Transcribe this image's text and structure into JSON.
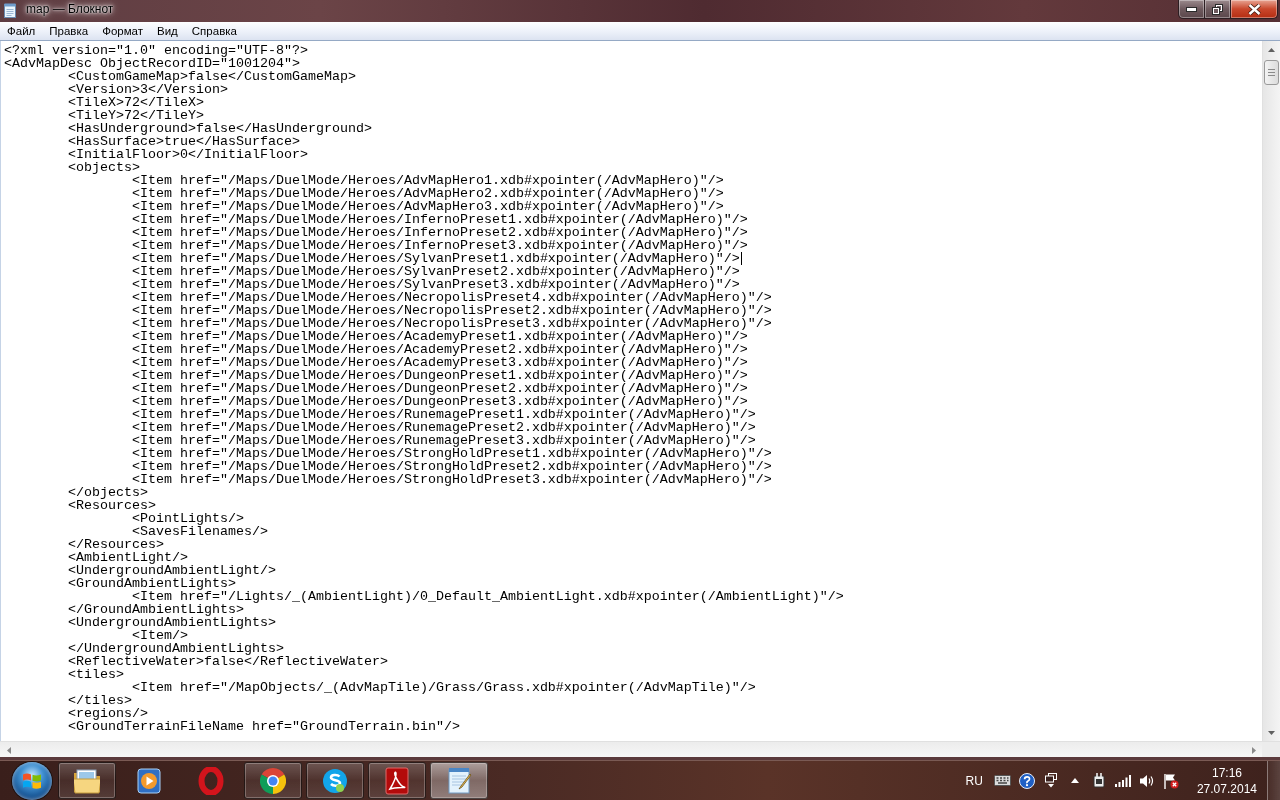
{
  "window": {
    "title": "map — Блокнот"
  },
  "menu": [
    "Файл",
    "Правка",
    "Формат",
    "Вид",
    "Справка"
  ],
  "editor": {
    "lines": [
      {
        "text": "<?xml version=\"1.0\" encoding=\"UTF-8\"?>",
        "caret": false
      },
      {
        "text": "<AdvMapDesc ObjectRecordID=\"1001204\">",
        "caret": false,
        "children": [
          {
            "text": "<CustomGameMap>false</CustomGameMap>",
            "caret": false
          },
          {
            "text": "<Version>3</Version>",
            "caret": false
          },
          {
            "text": "<TileX>72</TileX>",
            "caret": false
          },
          {
            "text": "<TileY>72</TileY>",
            "caret": false
          },
          {
            "text": "<HasUnderground>false</HasUnderground>",
            "caret": false
          },
          {
            "text": "<HasSurface>true</HasSurface>",
            "caret": false
          },
          {
            "text": "<InitialFloor>0</InitialFloor>",
            "caret": false
          },
          {
            "text": "<objects>",
            "caret": false,
            "children": [
              {
                "text": "<Item href=\"/Maps/DuelMode/Heroes/AdvMapHero1.xdb#xpointer(/AdvMapHero)\"/>",
                "caret": false
              },
              {
                "text": "<Item href=\"/Maps/DuelMode/Heroes/AdvMapHero2.xdb#xpointer(/AdvMapHero)\"/>",
                "caret": false
              },
              {
                "text": "<Item href=\"/Maps/DuelMode/Heroes/AdvMapHero3.xdb#xpointer(/AdvMapHero)\"/>",
                "caret": false
              },
              {
                "text": "<Item href=\"/Maps/DuelMode/Heroes/InfernoPreset1.xdb#xpointer(/AdvMapHero)\"/>",
                "caret": false
              },
              {
                "text": "<Item href=\"/Maps/DuelMode/Heroes/InfernoPreset2.xdb#xpointer(/AdvMapHero)\"/>",
                "caret": false
              },
              {
                "text": "<Item href=\"/Maps/DuelMode/Heroes/InfernoPreset3.xdb#xpointer(/AdvMapHero)\"/>",
                "caret": false
              },
              {
                "text": "<Item href=\"/Maps/DuelMode/Heroes/SylvanPreset1.xdb#xpointer(/AdvMapHero)\"/>",
                "caret": true
              },
              {
                "text": "<Item href=\"/Maps/DuelMode/Heroes/SylvanPreset2.xdb#xpointer(/AdvMapHero)\"/>",
                "caret": false
              },
              {
                "text": "<Item href=\"/Maps/DuelMode/Heroes/SylvanPreset3.xdb#xpointer(/AdvMapHero)\"/>",
                "caret": false
              },
              {
                "text": "<Item href=\"/Maps/DuelMode/Heroes/NecropolisPreset4.xdb#xpointer(/AdvMapHero)\"/>",
                "caret": false
              },
              {
                "text": "<Item href=\"/Maps/DuelMode/Heroes/NecropolisPreset2.xdb#xpointer(/AdvMapHero)\"/>",
                "caret": false
              },
              {
                "text": "<Item href=\"/Maps/DuelMode/Heroes/NecropolisPreset3.xdb#xpointer(/AdvMapHero)\"/>",
                "caret": false
              },
              {
                "text": "<Item href=\"/Maps/DuelMode/Heroes/AcademyPreset1.xdb#xpointer(/AdvMapHero)\"/>",
                "caret": false
              },
              {
                "text": "<Item href=\"/Maps/DuelMode/Heroes/AcademyPreset2.xdb#xpointer(/AdvMapHero)\"/>",
                "caret": false
              },
              {
                "text": "<Item href=\"/Maps/DuelMode/Heroes/AcademyPreset3.xdb#xpointer(/AdvMapHero)\"/>",
                "caret": false
              },
              {
                "text": "<Item href=\"/Maps/DuelMode/Heroes/DungeonPreset1.xdb#xpointer(/AdvMapHero)\"/>",
                "caret": false
              },
              {
                "text": "<Item href=\"/Maps/DuelMode/Heroes/DungeonPreset2.xdb#xpointer(/AdvMapHero)\"/>",
                "caret": false
              },
              {
                "text": "<Item href=\"/Maps/DuelMode/Heroes/DungeonPreset3.xdb#xpointer(/AdvMapHero)\"/>",
                "caret": false
              },
              {
                "text": "<Item href=\"/Maps/DuelMode/Heroes/RunemagePreset1.xdb#xpointer(/AdvMapHero)\"/>",
                "caret": false
              },
              {
                "text": "<Item href=\"/Maps/DuelMode/Heroes/RunemagePreset2.xdb#xpointer(/AdvMapHero)\"/>",
                "caret": false
              },
              {
                "text": "<Item href=\"/Maps/DuelMode/Heroes/RunemagePreset3.xdb#xpointer(/AdvMapHero)\"/>",
                "caret": false
              },
              {
                "text": "<Item href=\"/Maps/DuelMode/Heroes/StrongHoldPreset1.xdb#xpointer(/AdvMapHero)\"/>",
                "caret": false
              },
              {
                "text": "<Item href=\"/Maps/DuelMode/Heroes/StrongHoldPreset2.xdb#xpointer(/AdvMapHero)\"/>",
                "caret": false
              },
              {
                "text": "<Item href=\"/Maps/DuelMode/Heroes/StrongHoldPreset3.xdb#xpointer(/AdvMapHero)\"/>",
                "caret": false
              }
            ]
          },
          {
            "text": "</objects>",
            "caret": false
          },
          {
            "text": "<Resources>",
            "caret": false,
            "children": [
              {
                "text": "<PointLights/>",
                "caret": false
              },
              {
                "text": "<SavesFilenames/>",
                "caret": false
              }
            ]
          },
          {
            "text": "</Resources>",
            "caret": false
          },
          {
            "text": "<AmbientLight/>",
            "caret": false
          },
          {
            "text": "<UndergroundAmbientLight/>",
            "caret": false
          },
          {
            "text": "<GroundAmbientLights>",
            "caret": false,
            "children": [
              {
                "text": "<Item href=\"/Lights/_(AmbientLight)/0_Default_AmbientLight.xdb#xpointer(/AmbientLight)\"/>",
                "caret": false
              }
            ]
          },
          {
            "text": "</GroundAmbientLights>",
            "caret": false
          },
          {
            "text": "<UndergroundAmbientLights>",
            "caret": false,
            "children": [
              {
                "text": "<Item/>",
                "caret": false
              }
            ]
          },
          {
            "text": "</UndergroundAmbientLights>",
            "caret": false
          },
          {
            "text": "<ReflectiveWater>false</ReflectiveWater>",
            "caret": false
          },
          {
            "text": "<tiles>",
            "caret": false,
            "children": [
              {
                "text": "<Item href=\"/MapObjects/_(AdvMapTile)/Grass/Grass.xdb#xpointer(/AdvMapTile)\"/>",
                "caret": false
              }
            ]
          },
          {
            "text": "</tiles>",
            "caret": false
          },
          {
            "text": "<regions/>",
            "caret": false
          },
          {
            "text": "<GroundTerrainFileName href=\"GroundTerrain.bin\"/>",
            "caret": false
          }
        ]
      }
    ]
  },
  "taskbar": {
    "apps": [
      {
        "kind": "folder",
        "running": true,
        "active": false
      },
      {
        "kind": "player",
        "running": false,
        "active": false
      },
      {
        "kind": "ring",
        "running": false,
        "active": false
      },
      {
        "kind": "wheel",
        "running": true,
        "active": false
      },
      {
        "kind": "bubble",
        "running": true,
        "active": false
      },
      {
        "kind": "document",
        "running": true,
        "active": false
      },
      {
        "kind": "notepad",
        "running": true,
        "active": true
      }
    ],
    "tray": {
      "language": "RU",
      "time": "17:16",
      "date": "27.07.2014"
    }
  }
}
